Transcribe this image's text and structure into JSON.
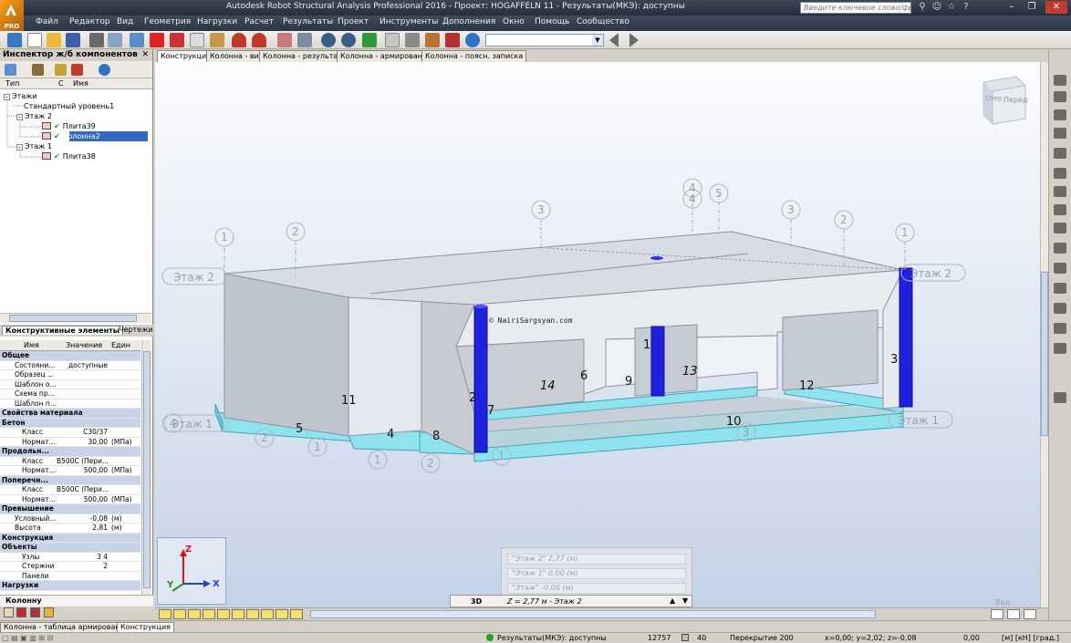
{
  "window": {
    "title": "Autodesk Robot Structural Analysis Professional 2016 - Проект: HOGAFFELN 11 - Результаты(МКЭ): доступны",
    "logo_text": "PRO",
    "search_placeholder": "Введите ключевое слово/фразу",
    "controls": [
      "–",
      "❐",
      "✕"
    ]
  },
  "menu": [
    "Файл",
    "Редактор",
    "Вид",
    "Геометрия",
    "Нагрузки",
    "Расчет",
    "Результаты",
    "Проект",
    "Инструменты",
    "Дополнения",
    "Окно",
    "Помощь",
    "Сообщество"
  ],
  "inspector": {
    "title": "Инспектор ж/б компонентов",
    "close": "✕",
    "columns": [
      "Тип",
      "С",
      "Имя"
    ],
    "tree": [
      {
        "label": "Этажи",
        "depth": 0,
        "expander": "–"
      },
      {
        "label": "Стандартный уровень1",
        "depth": 1,
        "expander": ""
      },
      {
        "label": "Этаж 2",
        "depth": 1,
        "expander": "–"
      },
      {
        "label": "Плита39",
        "depth": 2,
        "checked": true
      },
      {
        "label": "Колонна2",
        "depth": 2,
        "checked": true,
        "selected": true
      },
      {
        "label": "Этаж 1",
        "depth": 1,
        "expander": "–"
      },
      {
        "label": "Плита38",
        "depth": 2,
        "checked": true
      }
    ],
    "subtabs": [
      "Конструктивные элементы",
      "Чертежи"
    ],
    "prop_columns": [
      "Имя",
      "Значение",
      "Един"
    ],
    "properties": [
      {
        "name": "Общее",
        "group": true
      },
      {
        "name": "Состояни...",
        "value": "доступные",
        "unit": ""
      },
      {
        "name": "Образец ...",
        "value": "",
        "unit": ""
      },
      {
        "name": "Шаблон о...",
        "value": "",
        "unit": ""
      },
      {
        "name": "Схема пр...",
        "value": "",
        "unit": ""
      },
      {
        "name": "Шаблон п...",
        "value": "",
        "unit": ""
      },
      {
        "name": "Свойства материала",
        "group": true
      },
      {
        "name": "Бетон",
        "group": true
      },
      {
        "name": "Класс",
        "value": "C30/37",
        "unit": "",
        "indent": 2
      },
      {
        "name": "Нормат...",
        "value": "30,00",
        "unit": "(МПа)",
        "indent": 2
      },
      {
        "name": "Продольн...",
        "group": true
      },
      {
        "name": "Класс",
        "value": "B500C (Пери...",
        "unit": "",
        "indent": 2
      },
      {
        "name": "Нормат...",
        "value": "500,00",
        "unit": "(МПа)",
        "indent": 2
      },
      {
        "name": "Поперечн...",
        "group": true
      },
      {
        "name": "Класс",
        "value": "B500C (Пери...",
        "unit": "",
        "indent": 2
      },
      {
        "name": "Нормат...",
        "value": "500,00",
        "unit": "(МПа)",
        "indent": 2
      },
      {
        "name": "Превышение",
        "group": true
      },
      {
        "name": "Условный...",
        "value": "-0,08",
        "unit": "(м)"
      },
      {
        "name": "Высота",
        "value": "2,81",
        "unit": "(м)"
      },
      {
        "name": "Конструкция",
        "group": true
      },
      {
        "name": "Объекты",
        "group": true
      },
      {
        "name": "Узлы",
        "value": "3 4",
        "unit": "",
        "indent": 2
      },
      {
        "name": "Стержни",
        "value": "2",
        "unit": "",
        "indent": 2
      },
      {
        "name": "Панели",
        "value": "",
        "unit": "",
        "indent": 2
      },
      {
        "name": "Нагрузки",
        "group": true
      }
    ],
    "panel_tab": "Колонну"
  },
  "doc_tabs": [
    "Конструкция",
    "Колонна - вид",
    "Колонна - результаты",
    "Колонна - армирование",
    "Колонна - поясн. записка"
  ],
  "viewport": {
    "viewcube_left": "Спер",
    "viewcube_right": "Перед",
    "watermark": "© NairiSargsyan.com",
    "level_labels": [
      "Этаж 2",
      "Этаж 2",
      "Этаж 1",
      "Этаж 1"
    ],
    "axis_bubbles": [
      "1",
      "2",
      "3",
      "4",
      "5",
      "4",
      "3",
      "2",
      "1",
      "4",
      "3",
      "2",
      "1",
      "1",
      "2",
      "1"
    ],
    "element_numbers": [
      "1",
      "2",
      "3",
      "4",
      "5",
      "6",
      "7",
      "8",
      "9",
      "10",
      "11",
      "12",
      "13",
      "14"
    ],
    "triad": {
      "x": "X",
      "y": "Y",
      "z": "Z"
    },
    "view_label": "Вид"
  },
  "levels": {
    "rows": [
      "\"Этаж 2\" 2,77 (м)",
      "\"Этаж 1\" 0,00 (м)",
      "\"Этаж\" -0,08 (м)"
    ],
    "mode": "3D",
    "current": "Z = 2,77 м - Этаж 2",
    "up": "▲",
    "down": "▼"
  },
  "bottom_tabs": [
    "Колонна - таблица армирования",
    "Конструкция"
  ],
  "status": {
    "results": "Результаты(МКЭ): доступны",
    "nodes": "12757",
    "bars": "40",
    "section": "Перекрытие 200",
    "coords": "x=0,00; y=2,02; z=-0,08",
    "angle": "0,00",
    "units": "[м] [кН] [град.]"
  }
}
